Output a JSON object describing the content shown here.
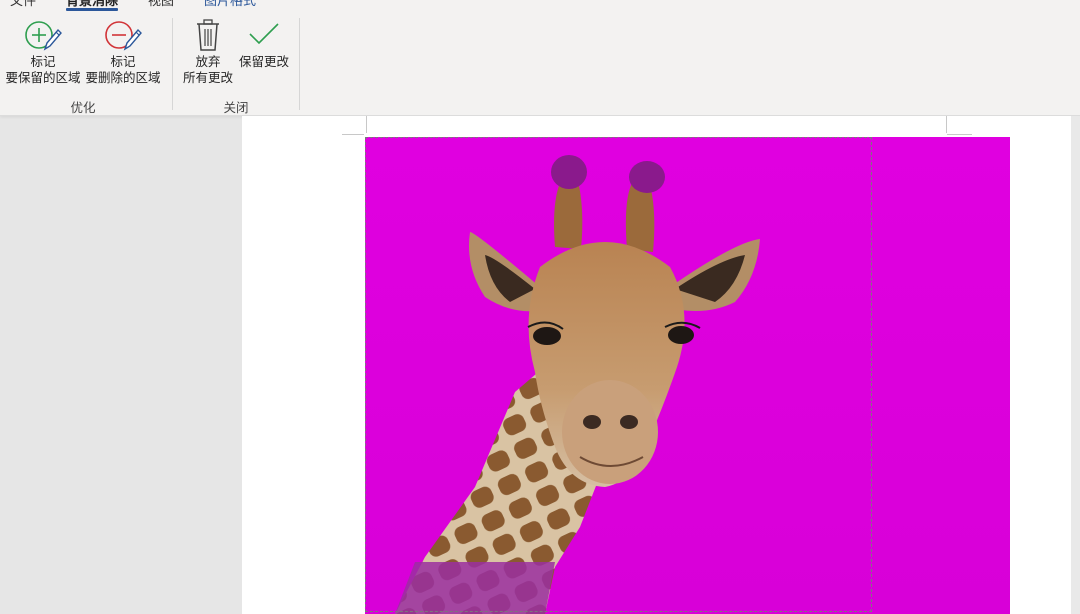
{
  "ribbon": {
    "tabs": [
      {
        "label": "文件"
      },
      {
        "label": "背景消除"
      },
      {
        "label": "视图"
      },
      {
        "label": "图片格式"
      }
    ],
    "buttons": {
      "mark_keep": {
        "line1": "标记",
        "line2": "要保留的区域",
        "icon": "plus-pen-icon"
      },
      "mark_remove": {
        "line1": "标记",
        "line2": "要删除的区域",
        "icon": "minus-pen-icon"
      },
      "discard": {
        "line1": "放弃",
        "line2": "所有更改",
        "icon": "trash-icon"
      },
      "keep_changes": {
        "line1": "保留更改",
        "icon": "checkmark-icon"
      }
    },
    "groups": {
      "refine": "优化",
      "close": "关闭"
    }
  },
  "colors": {
    "removal_overlay": "#e000e0",
    "accent": "#2b579a",
    "keep_icon": "#2e9e4f",
    "remove_icon": "#d13438"
  }
}
